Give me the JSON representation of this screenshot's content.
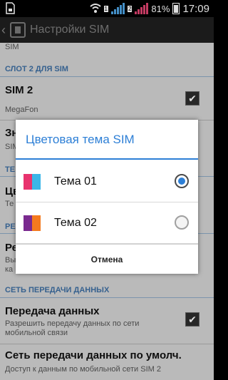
{
  "status_bar": {
    "badge_1": "1",
    "badge_2": "2",
    "battery": "81%",
    "time": "17:09",
    "signal_colors": [
      "#4ea3e3",
      "#e04470"
    ]
  },
  "action_bar": {
    "title": "Настройки SIM"
  },
  "list": {
    "top_sub": "SIM",
    "section_slot2": "СЛОТ 2 ДЛЯ SIM",
    "sim2_title": "SIM 2",
    "sim2_sub": "MegaFon",
    "hidden_row1_title": "Зн",
    "hidden_row1_sub": "SIM",
    "hidden_section": "ТЕ",
    "hidden_row2_title": "Цв",
    "hidden_row2_sub": "Те",
    "hidden_section2": "РЕ",
    "hidden_row3_title": "Ре",
    "hidden_row3_sub_1": "Вы",
    "hidden_row3_sub_2": "ка",
    "section_data": "СЕТЬ ПЕРЕДАЧИ ДАННЫХ",
    "data_title": "Передача данных",
    "data_sub_1": "Разрешить передачу данных по сети",
    "data_sub_2": "мобильной связи",
    "default_title": "Сеть передачи данных по умолч.",
    "default_sub": "Доступ к данным по мобильной сети SIM 2"
  },
  "dialog": {
    "title": "Цветовая тема SIM",
    "options": [
      {
        "label": "Тема 01",
        "colors": [
          "#e8336e",
          "#3bb6e8"
        ],
        "selected": true
      },
      {
        "label": "Тема 02",
        "colors": [
          "#7a2a8f",
          "#f47a1f"
        ],
        "selected": false
      }
    ],
    "cancel": "Отмена"
  },
  "colors": {
    "accent": "#2d7fd6",
    "section": "#3e6fa3"
  }
}
